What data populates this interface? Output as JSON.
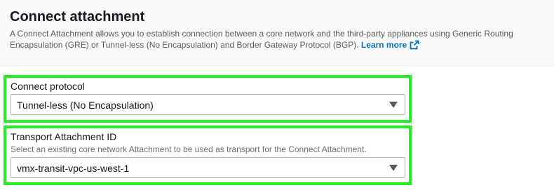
{
  "section": {
    "title": "Connect attachment",
    "description": "A Connect Attachment allows you to establish connection between a core network and the third-party appliances using Generic Routing Encapsulation (GRE) or Tunnel-less (No Encapsulation) and Border Gateway Protocol (BGP).",
    "learn_more": "Learn more",
    "link_color": "#0073bb"
  },
  "connect_protocol": {
    "label": "Connect protocol",
    "selected": "Tunnel-less (No Encapsulation)"
  },
  "transport_attachment": {
    "label": "Transport Attachment ID",
    "hint": "Select an existing core network Attachment to be used as transport for the Connect Attachment.",
    "selected": "vmx-transit-vpc-us-west-1"
  },
  "highlight_color": "#22ee22",
  "icons": [
    "external-link-icon",
    "caret-down-icon"
  ]
}
